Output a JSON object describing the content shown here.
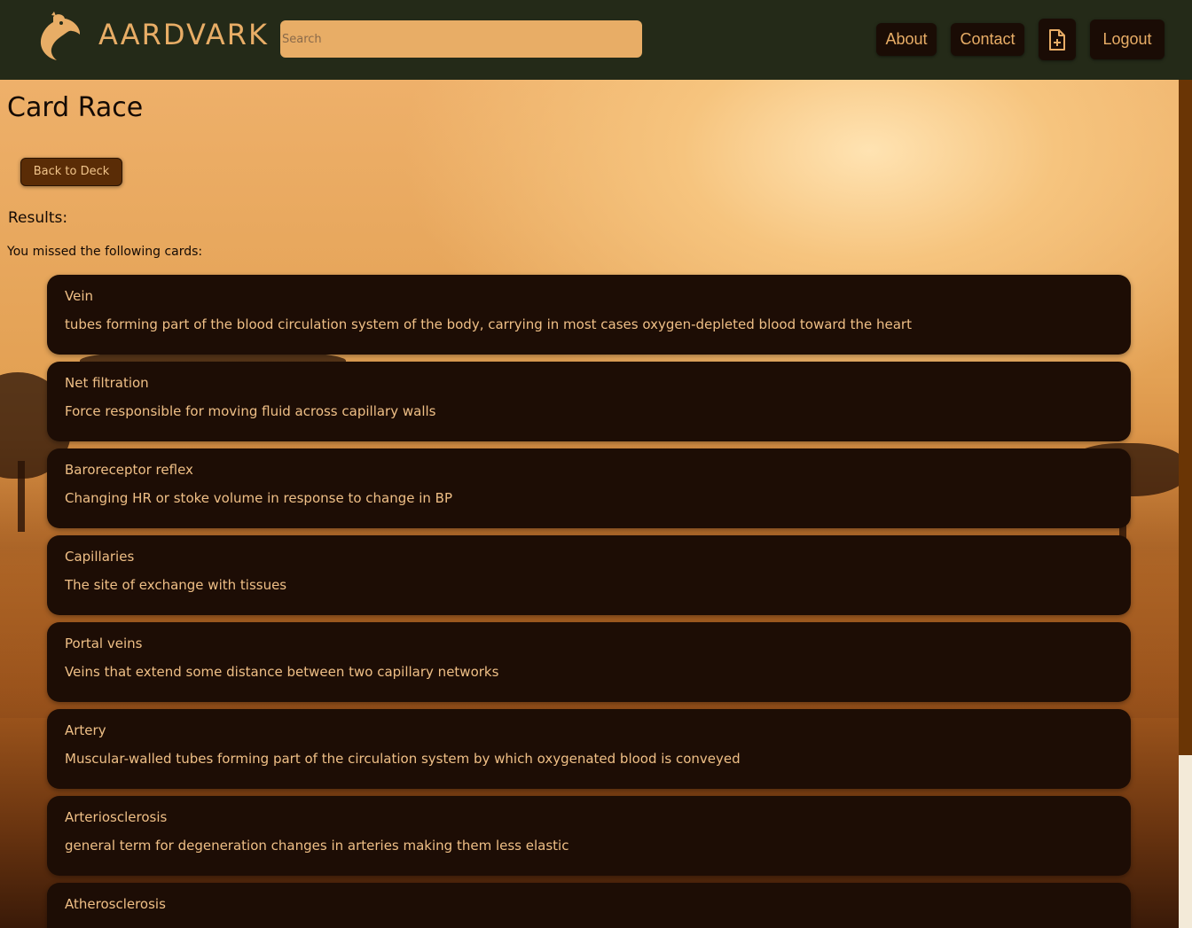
{
  "header": {
    "logo_icon": "aardvark-logo-icon",
    "brand": "AARDVARK",
    "search_placeholder": "Search",
    "search_value": "",
    "nav": {
      "about": "About",
      "contact": "Contact",
      "new_deck_icon": "file-plus-icon",
      "logout": "Logout"
    }
  },
  "page": {
    "title": "Card Race",
    "back_button": "Back to Deck",
    "results_label": "Results:",
    "missed_label": "You missed the following cards:"
  },
  "cards": [
    {
      "term": "Vein",
      "definition": "tubes forming part of the blood circulation system of the body, carrying in most cases oxygen-depleted blood toward the heart"
    },
    {
      "term": "Net filtration",
      "definition": "Force responsible for moving fluid across capillary walls"
    },
    {
      "term": "Baroreceptor reflex",
      "definition": "Changing HR or stoke volume in response to change in BP"
    },
    {
      "term": "Capillaries",
      "definition": "The site of exchange with tissues"
    },
    {
      "term": "Portal veins",
      "definition": "Veins that extend some distance between two capillary networks"
    },
    {
      "term": "Artery",
      "definition": "Muscular-walled tubes forming part of the circulation system by which oxygenated blood is conveyed"
    },
    {
      "term": "Arteriosclerosis",
      "definition": "general term for degeneration changes in arteries making them less elastic"
    },
    {
      "term": "Atherosclerosis",
      "definition": ""
    }
  ],
  "colors": {
    "header_bg": "#242a18",
    "accent": "#e8ad66",
    "card_bg": "#1d0d05",
    "card_text": "#efbf86"
  }
}
